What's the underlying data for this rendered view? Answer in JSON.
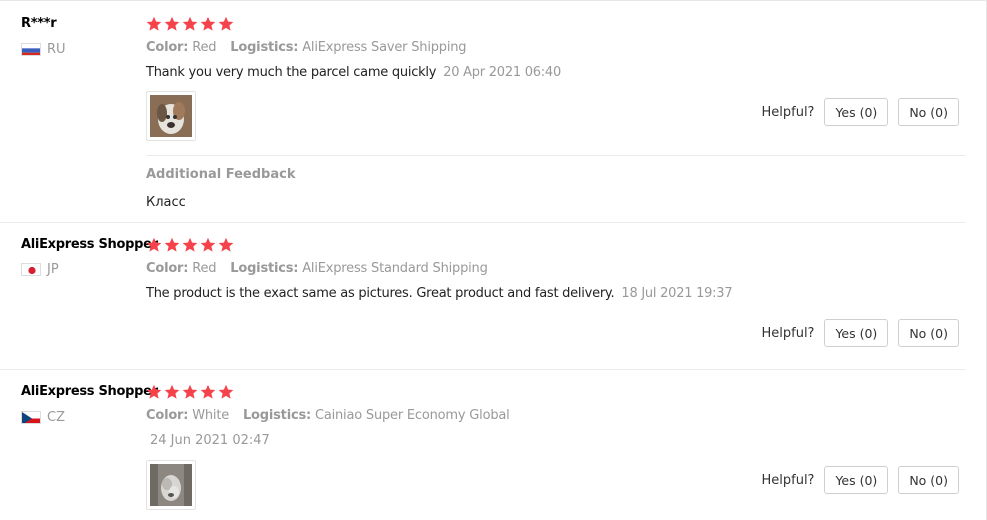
{
  "star_color": "#f5424b",
  "reviews": [
    {
      "user": "R***r",
      "country": "RU",
      "flag": "russia-flag",
      "rating": 5,
      "color_label": "Color:",
      "color_value": "Red",
      "logistics_label": "Logistics:",
      "logistics_value": "AliExpress Saver Shipping",
      "text": "Thank you very much the parcel came quickly",
      "date": "20 Apr 2021 06:40",
      "helpful_label": "Helpful?",
      "yes_label": "Yes (0)",
      "no_label": "No (0)",
      "additional_title": "Additional Feedback",
      "additional_text": "Класс"
    },
    {
      "user": "AliExpress Shopper",
      "country": "JP",
      "flag": "japan-flag",
      "rating": 5,
      "color_label": "Color:",
      "color_value": "Red",
      "logistics_label": "Logistics:",
      "logistics_value": "AliExpress Standard Shipping",
      "text": "The product is the exact same as pictures. Great product and fast delivery.",
      "date": "18 Jul 2021 19:37",
      "helpful_label": "Helpful?",
      "yes_label": "Yes (0)",
      "no_label": "No (0)"
    },
    {
      "user": "AliExpress Shopper",
      "country": "CZ",
      "flag": "czech-flag",
      "rating": 5,
      "color_label": "Color:",
      "color_value": "White",
      "logistics_label": "Logistics:",
      "logistics_value": "Cainiao Super Economy Global",
      "date": "24 Jun 2021 02:47",
      "helpful_label": "Helpful?",
      "yes_label": "Yes (0)",
      "no_label": "No (0)"
    }
  ]
}
